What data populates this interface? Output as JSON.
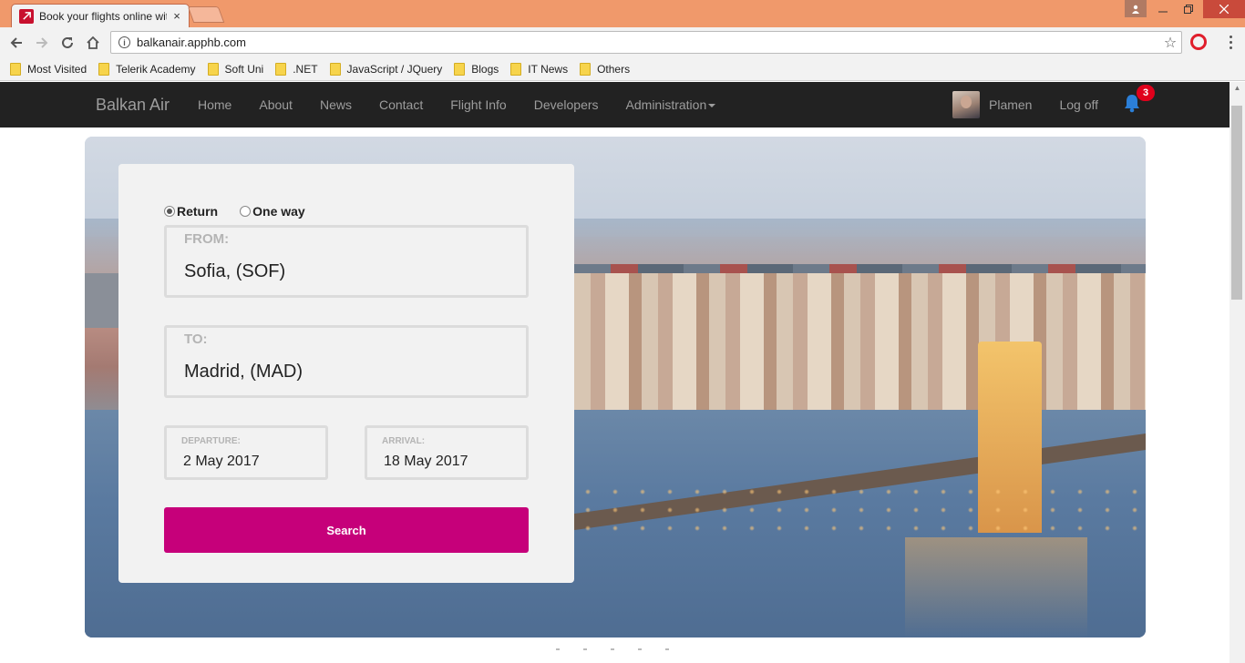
{
  "browser": {
    "tab_title": "Book your flights online with Balkan Air",
    "tab_close": "×",
    "url": "balkanair.apphb.com",
    "bookmarks": [
      {
        "label": "Most Visited"
      },
      {
        "label": "Telerik Academy"
      },
      {
        "label": "Soft Uni"
      },
      {
        "label": ".NET"
      },
      {
        "label": "JavaScript / JQuery"
      },
      {
        "label": "Blogs"
      },
      {
        "label": "IT News"
      },
      {
        "label": "Others"
      }
    ],
    "icons": {
      "back": "arrow-left",
      "forward": "arrow-right",
      "reload": "reload",
      "home": "home",
      "bookmark": "star",
      "opera": "opera-logo",
      "menu": "three-dots"
    }
  },
  "navbar": {
    "brand": "Balkan Air",
    "links": [
      "Home",
      "About",
      "News",
      "Contact",
      "Flight Info",
      "Developers",
      "Administration"
    ],
    "user_name": "Plamen",
    "logoff": "Log off",
    "notifications_count": "3"
  },
  "search_form": {
    "trip_types": [
      {
        "label": "Return",
        "checked": true
      },
      {
        "label": "One way",
        "checked": false
      }
    ],
    "from_label": "FROM:",
    "from_value": "Sofia, (SOF)",
    "to_label": "TO:",
    "to_value": "Madrid, (MAD)",
    "departure_label": "DEPARTURE:",
    "departure_value": "2 May 2017",
    "arrival_label": "ARRIVAL:",
    "arrival_value": "18 May 2017",
    "search_label": "Search"
  },
  "colors": {
    "navbar_bg": "#222222",
    "accent": "#c6007a",
    "titlebar": "#f0996b",
    "badge": "#e0001b"
  }
}
